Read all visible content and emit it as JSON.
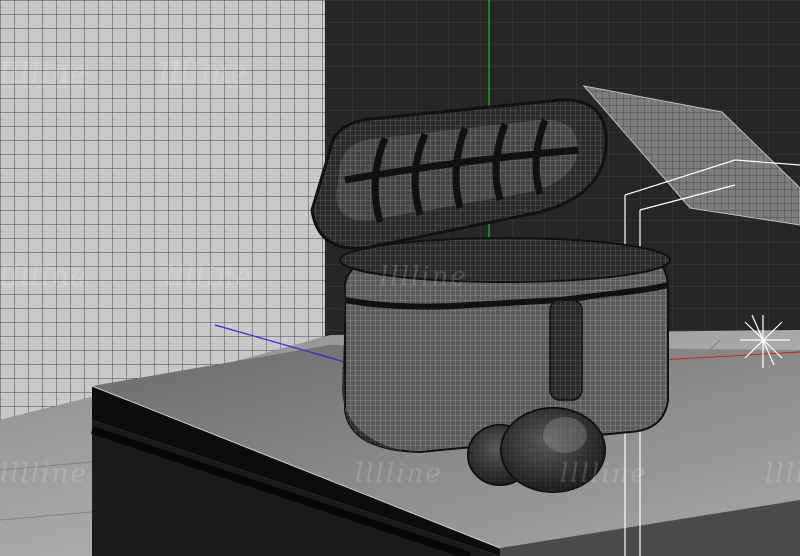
{
  "viewport": {
    "mode": "3d-perspective",
    "display": "wireframe-on-shaded"
  },
  "watermark": {
    "text": "lllline",
    "color": "#ffffff"
  },
  "scene": {
    "object": "earbuds-charging-case",
    "parts": [
      "case-lid",
      "case-body",
      "earbud-left",
      "earbud-right",
      "pedestal",
      "floor-plane",
      "back-wall",
      "side-wall",
      "light-panel",
      "area-light"
    ]
  },
  "axes": {
    "y_color": "#18c018",
    "x_color": "#d02020",
    "z_color": "#2f2fd8"
  },
  "colors": {
    "viewport_bg": "#3a3a3a",
    "wire_dark": "#1a1a1a",
    "wire_light": "#8a8a8a",
    "selection_box": "#ffffff"
  }
}
